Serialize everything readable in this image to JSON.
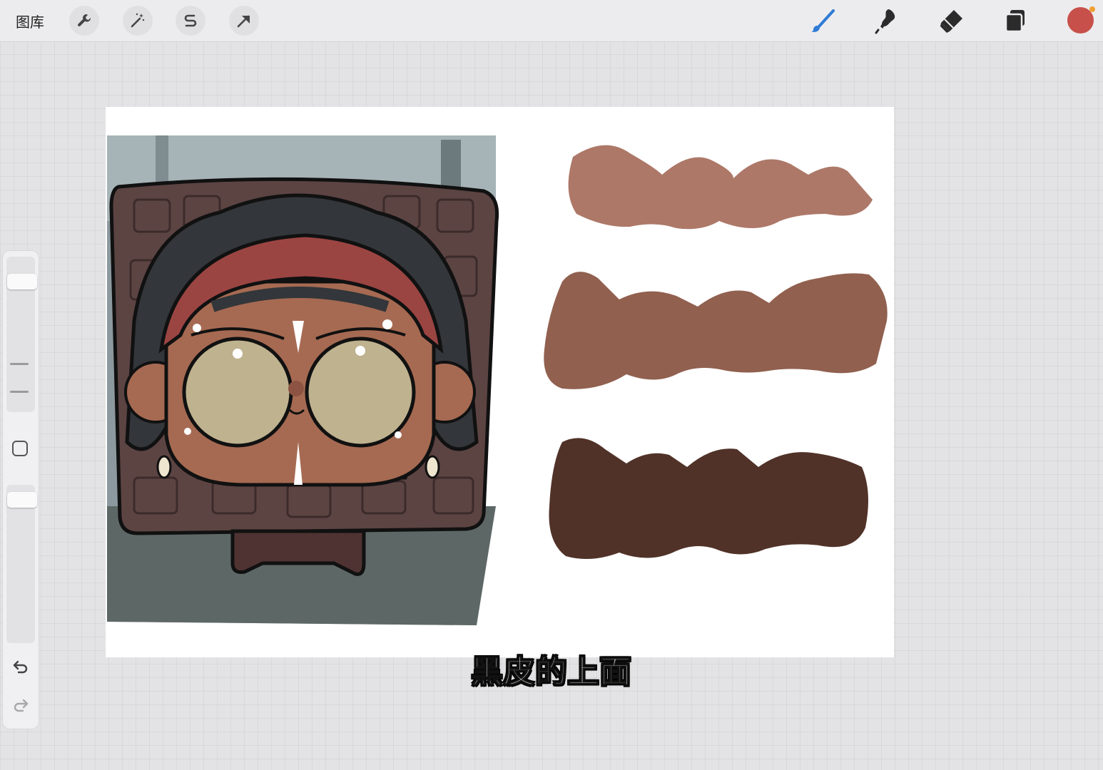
{
  "app": {
    "gallery_label": "图库"
  },
  "toolbar_left": [
    {
      "icon": "wrench-icon"
    },
    {
      "icon": "magic-wand-icon"
    },
    {
      "icon": "selection-s-icon"
    },
    {
      "icon": "transform-arrow-icon"
    }
  ],
  "toolbar_right": [
    {
      "icon": "brush-icon",
      "active_color": "#2f7bd6"
    },
    {
      "icon": "smudge-icon"
    },
    {
      "icon": "eraser-icon"
    },
    {
      "icon": "layers-icon"
    }
  ],
  "colors": {
    "current": "#c8504a",
    "indicator": "#f0a032",
    "stroke_light": "#ad7868",
    "stroke_mid": "#91604f",
    "stroke_dark": "#513228",
    "headband": "#9b4543",
    "skin": "#a66a52",
    "eye": "#bfb28f",
    "hair": "#33363a",
    "crate": "#5c4443"
  },
  "sidebar": {
    "brush_size": 0.88,
    "opacity": 0.95,
    "icons": [
      "modify-square-icon",
      "undo-icon",
      "redo-icon"
    ]
  },
  "caption": "黑皮的上面"
}
